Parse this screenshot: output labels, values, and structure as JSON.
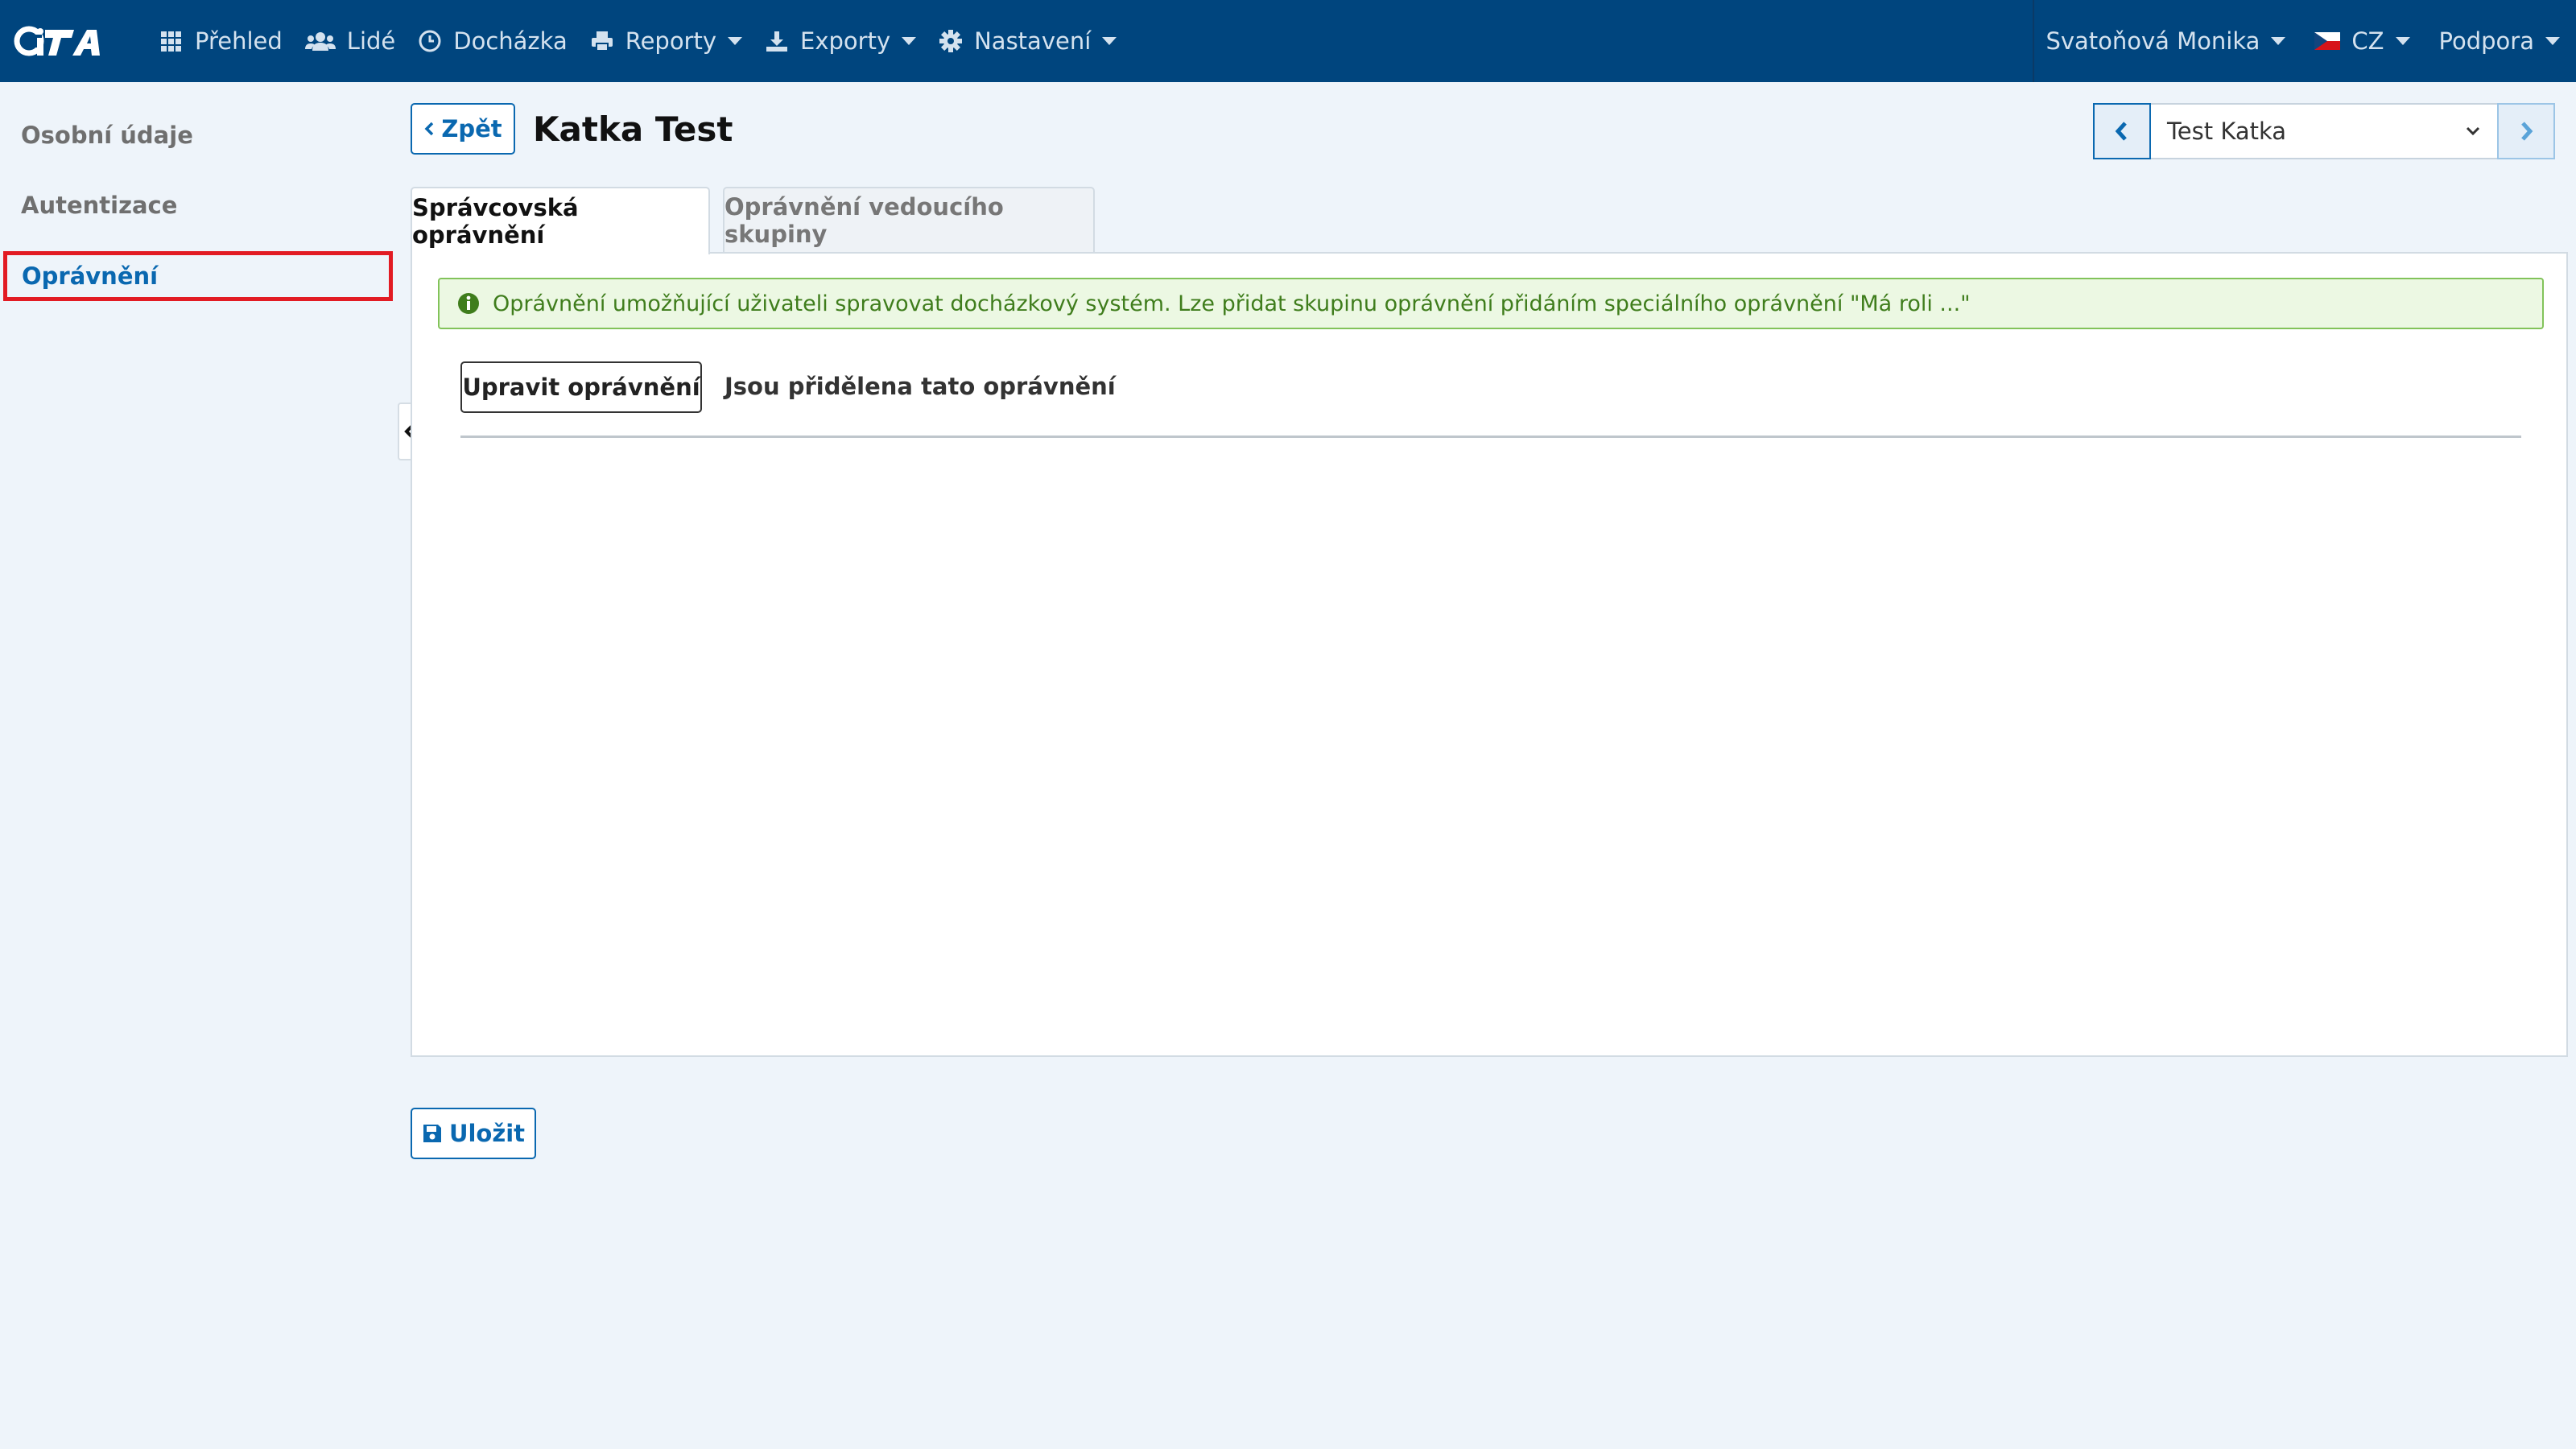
{
  "navbar": {
    "logo_text": "CiTA",
    "items": [
      {
        "label": "Přehled",
        "icon": "grid-icon"
      },
      {
        "label": "Lidé",
        "icon": "users-icon"
      },
      {
        "label": "Docházka",
        "icon": "clock-icon"
      },
      {
        "label": "Reporty",
        "icon": "printer-icon"
      },
      {
        "label": "Exporty",
        "icon": "export-icon"
      },
      {
        "label": "Nastavení",
        "icon": "gear-icon"
      }
    ],
    "user": "Svatoňová Monika",
    "language": "CZ",
    "support": "Podpora"
  },
  "sidebar": {
    "items": [
      {
        "label": "Osobní údaje"
      },
      {
        "label": "Autentizace"
      },
      {
        "label": "Oprávnění",
        "active": true
      }
    ]
  },
  "header": {
    "back_label": "Zpět",
    "title": "Katka Test",
    "selected_person": "Test Katka"
  },
  "tabs": [
    {
      "label": "Správcovská oprávnění",
      "active": true
    },
    {
      "label": "Oprávnění vedoucího skupiny",
      "active": false
    }
  ],
  "panel": {
    "alert_text": "Oprávnění umožňující uživateli spravovat docházkový systém. Lze přidat skupinu oprávnění přidáním speciálního oprávnění \"Má roli ...\"",
    "edit_button": "Upravit oprávnění",
    "assigned_label": "Jsou přidělena tato oprávnění"
  },
  "footer": {
    "save_label": "Uložit"
  },
  "colors": {
    "navbar": "#00457e",
    "accent": "#0a68b0",
    "alert_bg": "#ecf8e3",
    "alert_text": "#3f7d1c",
    "highlight": "#e21b23"
  }
}
